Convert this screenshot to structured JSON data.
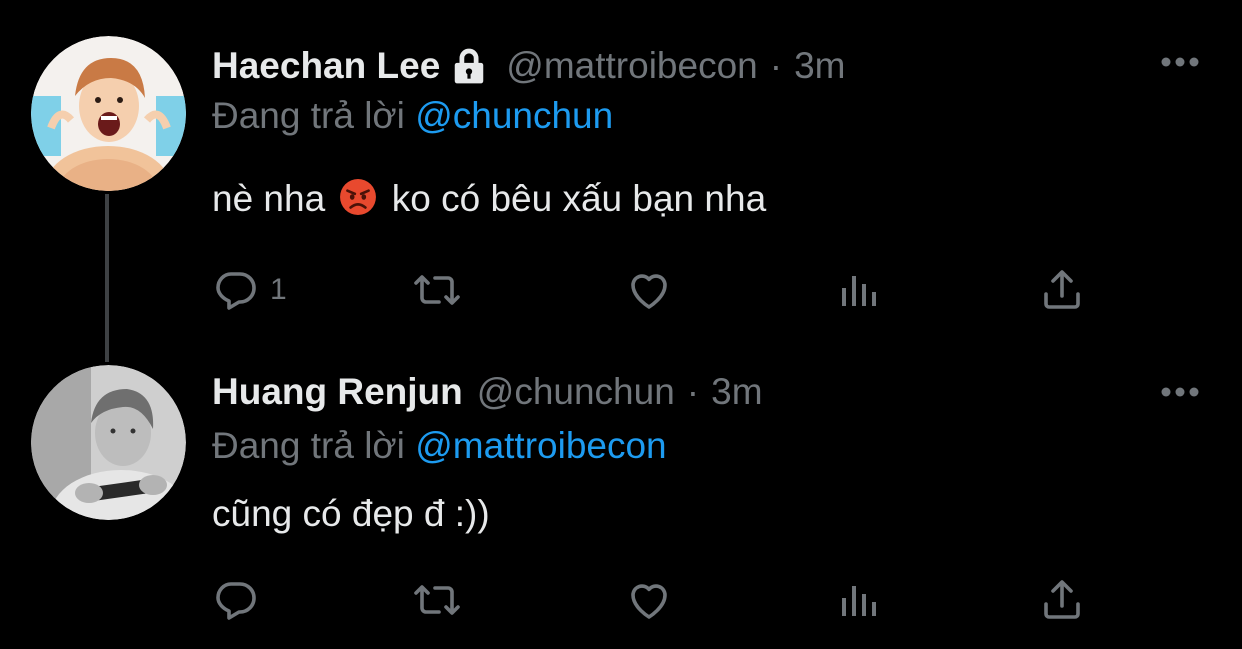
{
  "thread": [
    {
      "author_name": "Haechan Lee",
      "protected": true,
      "handle": "@mattroibecon",
      "separator": "·",
      "time": "3m",
      "replying_prefix": "Đang trả lời",
      "replying_to": "@chunchun",
      "text_before_emoji": "nè nha",
      "emoji": "angry-face",
      "text_after_emoji": "ko có bêu xấu bạn nha",
      "reply_count": "1"
    },
    {
      "author_name": "Huang Renjun",
      "protected": false,
      "handle": "@chunchun",
      "separator": "·",
      "time": "3m",
      "replying_prefix": "Đang trả lời",
      "replying_to": "@mattroibecon",
      "text": "cũng có đẹp đ :))"
    }
  ],
  "icons": {
    "lock": "lock-icon",
    "more": "more-horizontal-icon",
    "reply": "reply-icon",
    "retweet": "retweet-icon",
    "like": "like-icon",
    "views": "views-icon",
    "share": "share-icon"
  },
  "colors": {
    "background": "#000000",
    "primary_text": "#e7e9ea",
    "secondary_text": "#71767b",
    "link": "#1d9bf0",
    "thread_line": "#3e4144"
  }
}
